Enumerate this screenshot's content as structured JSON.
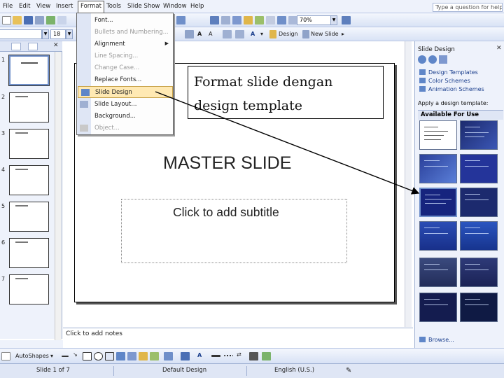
{
  "menu": {
    "items": [
      "File",
      "Edit",
      "View",
      "Insert",
      "Format",
      "Tools",
      "Slide Show",
      "Window",
      "Help"
    ],
    "help_placeholder": "Type a question for help"
  },
  "toolbar": {
    "zoom": "70%",
    "font_size": "18",
    "design_label": "Design",
    "new_slide_label": "New Slide"
  },
  "format_menu": {
    "items": [
      {
        "label": "Font...",
        "enabled": true
      },
      {
        "label": "Bullets and Numbering...",
        "enabled": false
      },
      {
        "label": "Alignment",
        "enabled": true,
        "submenu": true
      },
      {
        "label": "Line Spacing...",
        "enabled": false
      },
      {
        "label": "Change Case...",
        "enabled": false
      },
      {
        "label": "Replace Fonts...",
        "enabled": true
      },
      {
        "label": "Slide Design",
        "enabled": true,
        "highlighted": true
      },
      {
        "label": "Slide Layout...",
        "enabled": true
      },
      {
        "label": "Background...",
        "enabled": true
      },
      {
        "label": "Object...",
        "enabled": false
      }
    ]
  },
  "slides_pane": {
    "slides": [
      "1",
      "2",
      "3",
      "4",
      "5",
      "6",
      "7"
    ],
    "selected": 1
  },
  "slide": {
    "title": "MASTER SLIDE",
    "subtitle_placeholder": "Click to add subtitle",
    "callout": "Format slide dengan design template"
  },
  "notes_placeholder": "Click to add notes",
  "task_pane": {
    "title": "Slide Design",
    "links": [
      "Design Templates",
      "Color Schemes",
      "Animation Schemes"
    ],
    "apply_label": "Apply a design template:",
    "section_label": "Available For Use",
    "browse_label": "Browse..."
  },
  "drawing_toolbar": {
    "autoshapes_label": "AutoShapes"
  },
  "status_bar": {
    "slide_position": "Slide 1 of 7",
    "design_name": "Default Design",
    "language": "English (U.S.)"
  },
  "colors": {
    "office_blue_light": "#eef2fb",
    "menu_highlight": "#ffe9b3",
    "template_dark_blue": "#1c2a6e",
    "link_blue": "#1a3e8c"
  }
}
